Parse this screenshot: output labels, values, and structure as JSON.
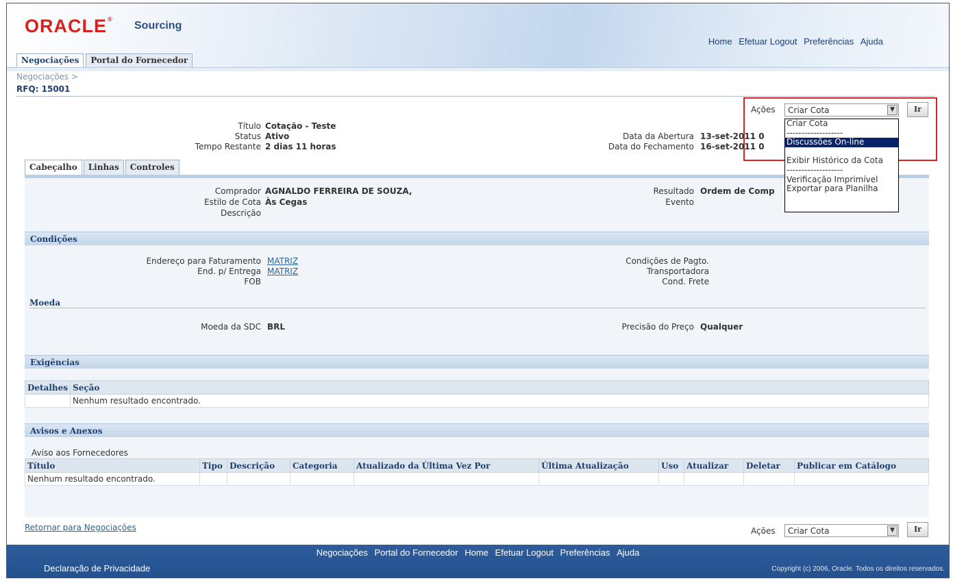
{
  "header": {
    "logo": "ORACLE",
    "logo_reg": "®",
    "product": "Sourcing",
    "global_links": [
      "Home",
      "Efetuar Logout",
      "Preferências",
      "Ajuda"
    ],
    "tabs": [
      "Negociações",
      "Portal do Fornecedor"
    ]
  },
  "breadcrumb": "Negociações  >",
  "page_title": "RFQ: 15001",
  "actions": {
    "label": "Ações",
    "selected": "Criar Cota",
    "go_label": "Ir",
    "options": [
      "Criar Cota",
      "-------------------",
      "Discussões On-line",
      "",
      "Exibir Histórico da Cota",
      "-------------------",
      "Verificação Imprimível",
      "Exportar para Planilha"
    ]
  },
  "summary": {
    "titulo_label": "Título",
    "titulo_value": "Cotação - Teste",
    "status_label": "Status",
    "status_value": "Ativo",
    "tempo_label": "Tempo Restante",
    "tempo_value": "2 dias 11 horas",
    "abertura_label": "Data da Abertura",
    "abertura_value": "13-set-2011 0",
    "fechamento_label": "Data do Fechamento",
    "fechamento_value": "16-set-2011 0"
  },
  "subtabs": [
    "Cabeçalho",
    "Linhas",
    "Controles"
  ],
  "cabecalho": {
    "comprador_label": "Comprador",
    "comprador_value": "AGNALDO FERREIRA DE SOUZA,",
    "estilo_label": "Estilo de Cota",
    "estilo_value": "Às Cegas",
    "descricao_label": "Descrição",
    "resultado_label": "Resultado",
    "resultado_value": "Ordem de Comp",
    "evento_label": "Evento"
  },
  "condicoes": {
    "title": "Condições",
    "faturamento_label": "Endereço para Faturamento",
    "faturamento_value": "MATRIZ",
    "entrega_label": "End. p/ Entrega",
    "entrega_value": "MATRIZ",
    "fob_label": "FOB",
    "pagto_label": "Condições de Pagto.",
    "transportadora_label": "Transportadora",
    "frete_label": "Cond. Frete"
  },
  "moeda": {
    "title": "Moeda",
    "moeda_label": "Moeda da SDC",
    "moeda_value": "BRL",
    "precisao_label": "Precisão do Preço",
    "precisao_value": "Qualquer"
  },
  "exigencias": {
    "title": "Exigências",
    "columns": [
      "Detalhes",
      "Seção"
    ],
    "empty": "Nenhum resultado encontrado."
  },
  "avisos": {
    "title": "Avisos e Anexos",
    "subtitle": "Aviso aos Fornecedores",
    "columns": [
      "Título",
      "Tipo",
      "Descrição",
      "Categoria",
      "Atualizado da Última Vez Por",
      "Última Atualização",
      "Uso",
      "Atualizar",
      "Deletar",
      "Publicar em Catálogo"
    ],
    "empty": "Nenhum resultado encontrado."
  },
  "return_link": "Retornar para Negociações",
  "footer": {
    "links": [
      "Negociações",
      "Portal do Fornecedor",
      "Home",
      "Efetuar Logout",
      "Preferências",
      "Ajuda"
    ],
    "privacy": "Declaração de Privacidade",
    "copyright": "Copyright (c) 2006, Oracle. Todos os direitos reservados."
  },
  "colors": {
    "highlight": "#e02020",
    "footer_bg": "#2e5c9b",
    "section_header": "#c4d6ea",
    "link": "#2a6496"
  }
}
